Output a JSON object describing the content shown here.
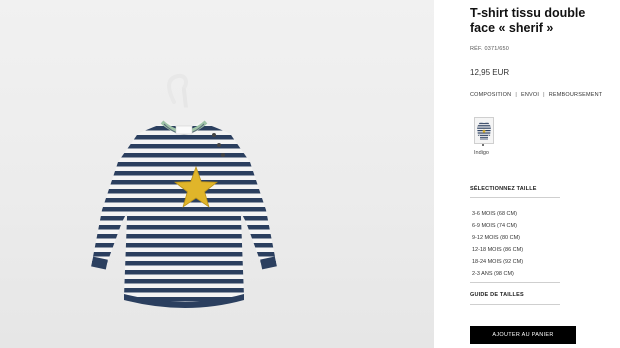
{
  "product": {
    "title_line1": "T-shirt tissu double",
    "title_line2": "face « sherif »",
    "reference": "RÉF. 0371/650",
    "price": "12,95 EUR"
  },
  "info_links": {
    "composition": "COMPOSITION",
    "shipping": "ENVOI",
    "refund": "REMBOURSEMENT",
    "separator": "|"
  },
  "colors": [
    {
      "name": "Indigo",
      "icon": "striped-shirt-thumbnail-icon",
      "selected": true
    }
  ],
  "size_selector": {
    "heading": "SÉLECTIONNEZ TAILLE",
    "options": [
      "3-6 MOIS (68 CM)",
      "6-9 MOIS (74 CM)",
      "9-12 MOIS (80 CM)",
      "12-18 MOIS (86 CM)",
      "18-24 MOIS (92 CM)",
      "2-3 ANS (98 CM)"
    ]
  },
  "size_guide": "GUIDE DE TAILLES",
  "add_to_cart": "AJOUTER AU PANIER",
  "theme": {
    "stripe_navy": "#2b3f5f",
    "star_yellow": "#e0b52a",
    "button_black": "#000000"
  }
}
